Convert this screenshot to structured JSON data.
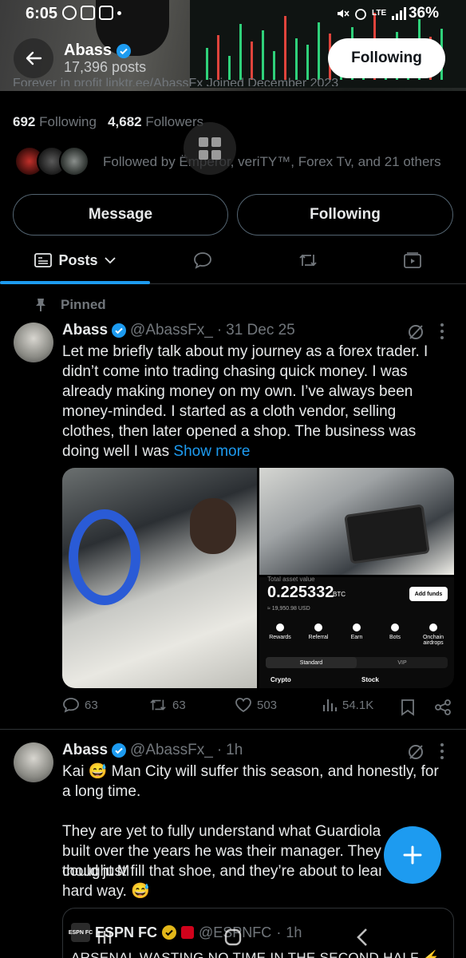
{
  "status_bar": {
    "time": "6:05",
    "network": "LTE",
    "battery": "36%"
  },
  "header": {
    "name": "Abass",
    "posts_count": "17,396 posts",
    "follow_button": "Following"
  },
  "profile": {
    "meta_cut": "Forever in profit   linktr.ee/AbassFx   Joined December 2023",
    "following_count": "692",
    "following_label": "Following",
    "followers_count": "4,682",
    "followers_label": "Followers",
    "followed_by": "Followed by Ëmperor, veriTY™, Forex Tv, and 21 others",
    "message_button": "Message",
    "following_button": "Following"
  },
  "tabs": {
    "posts": "Posts"
  },
  "pinned_label": "Pinned",
  "posts": [
    {
      "name": "Abass",
      "handle": "@AbassFx_",
      "sep": "·",
      "date": "31 Dec 25",
      "text": "Let me briefly talk about my journey as a forex trader. I didn’t come into trading chasing quick money. I was already making money on my own. I’ve always been money-minded. I started as a cloth vendor, selling clothes, then later opened a shop. The business was doing well I was ",
      "show_more": "Show more",
      "replies": "63",
      "reposts": "63",
      "likes": "503",
      "views": "54.1K",
      "media": {
        "asset_label": "Total asset value",
        "btc_value": "0.225332",
        "btc_unit": "BTC",
        "usd_value": "≈ 19,950.98 USD",
        "add_funds": "Add funds",
        "buttons": [
          "Rewards",
          "Referral",
          "Earn",
          "Bots",
          "Onchain airdrops"
        ],
        "plan_tabs": [
          "Standard",
          "VIP"
        ],
        "bottom_tabs": [
          "Crypto",
          "Stock"
        ]
      }
    },
    {
      "name": "Abass",
      "handle": "@AbassFx_",
      "sep": "·",
      "date": "1h",
      "line1": "Kai 😅 Man City will suffer this season, and honestly, for a long time.",
      "line2": "They are yet to fully understand what Guardiola built over the years he was their manager. They thought M",
      "line3": "could just fill that shoe, and they’re about to lean",
      "line4": "hard way. 😅",
      "quote": {
        "logo": "ESPN FC",
        "name": "ESPN FC",
        "handle": "@ESPNFC",
        "sep": "·",
        "time": "1h",
        "text": "ARSENAL WASTING NO TIME IN THE SECOND HALF ⚡"
      }
    }
  ],
  "colors": {
    "accent": "#1d9bf0",
    "muted": "#71767b",
    "text": "#e7e9ea",
    "border": "#2f3336"
  }
}
